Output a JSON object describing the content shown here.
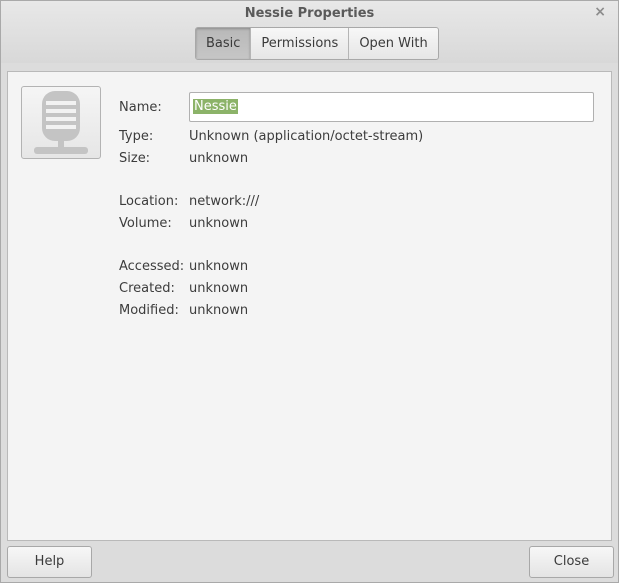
{
  "window": {
    "title": "Nessie Properties",
    "close_glyph": "×"
  },
  "tabs": [
    {
      "label": "Basic",
      "active": true
    },
    {
      "label": "Permissions",
      "active": false
    },
    {
      "label": "Open With",
      "active": false
    }
  ],
  "icon": {
    "name": "network-server-icon"
  },
  "fields": {
    "name_label": "Name:",
    "name_value": "Nessie",
    "type_label": "Type:",
    "type_value": "Unknown (application/octet-stream)",
    "size_label": "Size:",
    "size_value": "unknown",
    "location_label": "Location:",
    "location_value": "network:///",
    "volume_label": "Volume:",
    "volume_value": "unknown",
    "accessed_label": "Accessed:",
    "accessed_value": "unknown",
    "created_label": "Created:",
    "created_value": "unknown",
    "modified_label": "Modified:",
    "modified_value": "unknown"
  },
  "buttons": {
    "help": "Help",
    "close": "Close"
  }
}
